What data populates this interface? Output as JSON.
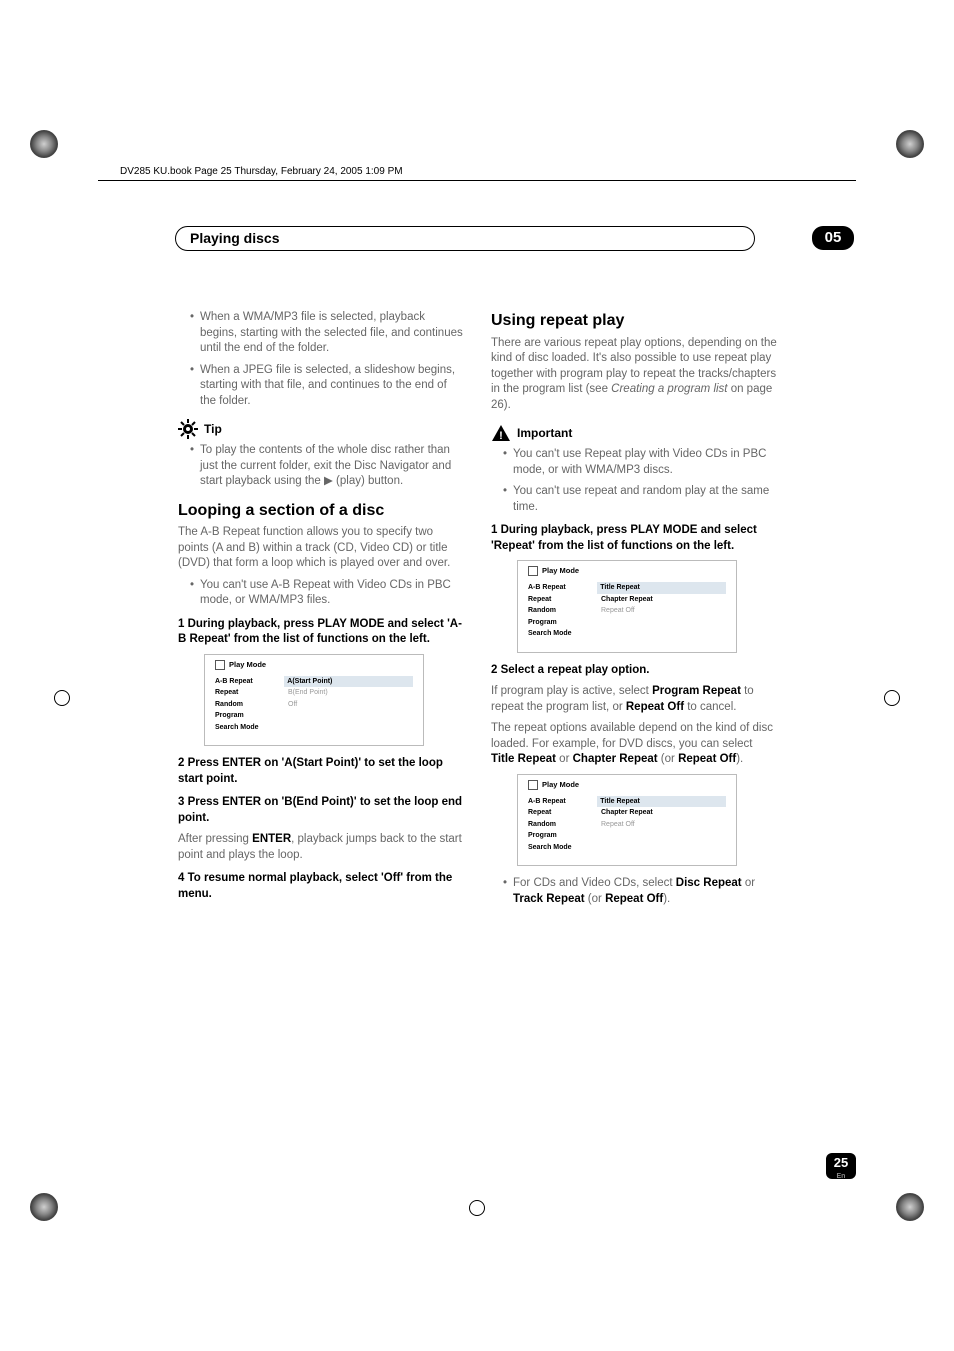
{
  "header_line": "DV285 KU.book  Page 25  Thursday, February 24, 2005  1:09 PM",
  "chapter": {
    "title": "Playing discs",
    "number": "05"
  },
  "page": {
    "number": "25",
    "lang": "En"
  },
  "left": {
    "intro_bullets": [
      "When a WMA/MP3 file is selected, playback begins, starting with the selected file, and continues until the end of the folder.",
      "When a JPEG file is selected, a slideshow begins, starting with that file, and continues to the end of the folder."
    ],
    "tip_label": "Tip",
    "tip_bullet": "To play the contents of the whole disc rather than just the current folder, exit the Disc Navigator and start playback using the ▶ (play) button.",
    "h2": "Looping a section of a disc",
    "looping_intro": "The A-B Repeat function allows you to specify two points (A and B) within a track (CD, Video CD) or title (DVD) that form a loop which is played over and over.",
    "looping_bullet": "You can't use A-B Repeat with Video CDs in PBC mode, or WMA/MP3 files.",
    "step1": "1    During playback, press PLAY MODE and select 'A-B Repeat' from the list of functions on the left.",
    "osd1": {
      "title": "Play Mode",
      "rows": [
        {
          "l": "A-B Repeat",
          "r": "A(Start Point)",
          "hl": true
        },
        {
          "l": "Repeat",
          "r": "B(End Point)",
          "grey": true
        },
        {
          "l": "Random",
          "r": "Off",
          "grey": true
        },
        {
          "l": "Program",
          "r": ""
        },
        {
          "l": "Search Mode",
          "r": ""
        }
      ]
    },
    "step2": "2    Press ENTER on 'A(Start Point)' to set the loop start point.",
    "step3": "3    Press ENTER on 'B(End Point)' to set the loop end point.",
    "step3_after_a": "After pressing ",
    "step3_enter": "ENTER",
    "step3_after_b": ", playback jumps back to the start point and plays the loop.",
    "step4": "4    To resume normal playback, select 'Off' from the menu."
  },
  "right": {
    "h2": "Using repeat play",
    "intro_a": "There are various repeat play options, depending on the kind of disc loaded. It's also possible to use repeat play together with program play to repeat the tracks/chapters in the program list (see ",
    "intro_italic": "Creating a program list",
    "intro_b": " on page 26).",
    "imp_label": "Important",
    "imp_bullets": [
      "You can't use Repeat play with Video CDs in PBC mode, or with WMA/MP3 discs.",
      "You can't use repeat and random play at the same time."
    ],
    "step1": "1    During playback, press PLAY MODE and select 'Repeat' from the list of functions on the left.",
    "osd1": {
      "title": "Play Mode",
      "rows": [
        {
          "l": "A-B Repeat",
          "r": "Title Repeat",
          "hl": true
        },
        {
          "l": "Repeat",
          "r": "Chapter Repeat"
        },
        {
          "l": "Random",
          "r": "Repeat Off",
          "grey": true
        },
        {
          "l": "Program",
          "r": ""
        },
        {
          "l": "Search Mode",
          "r": ""
        }
      ]
    },
    "step2": "2    Select a repeat play option.",
    "step2_a": "If program play is active, select ",
    "b_program_repeat": "Program Repeat",
    "step2_b": " to repeat the program list, or ",
    "b_repeat_off": "Repeat Off",
    "step2_c": " to cancel.",
    "para2_a": "The repeat options available depend on the kind of disc loaded. For example, for DVD discs, you can select ",
    "b_title_repeat": "Title Repeat",
    "para2_b": " or ",
    "b_chapter_repeat": "Chapter Repeat",
    "para2_c": " (or ",
    "b_repeat_off2": "Repeat Off",
    "para2_d": ").",
    "osd2": {
      "title": "Play Mode",
      "rows": [
        {
          "l": "A-B Repeat",
          "r": "Title Repeat",
          "hl": true
        },
        {
          "l": "Repeat",
          "r": "Chapter Repeat"
        },
        {
          "l": "Random",
          "r": "Repeat Off",
          "grey": true
        },
        {
          "l": "Program",
          "r": ""
        },
        {
          "l": "Search Mode",
          "r": ""
        }
      ]
    },
    "cd_a": "For CDs and Video CDs, select ",
    "b_disc_repeat": "Disc Repeat",
    "cd_b": " or ",
    "b_track_repeat": "Track Repeat",
    "cd_c": " (or ",
    "b_repeat_off3": "Repeat Off",
    "cd_d": ")."
  }
}
